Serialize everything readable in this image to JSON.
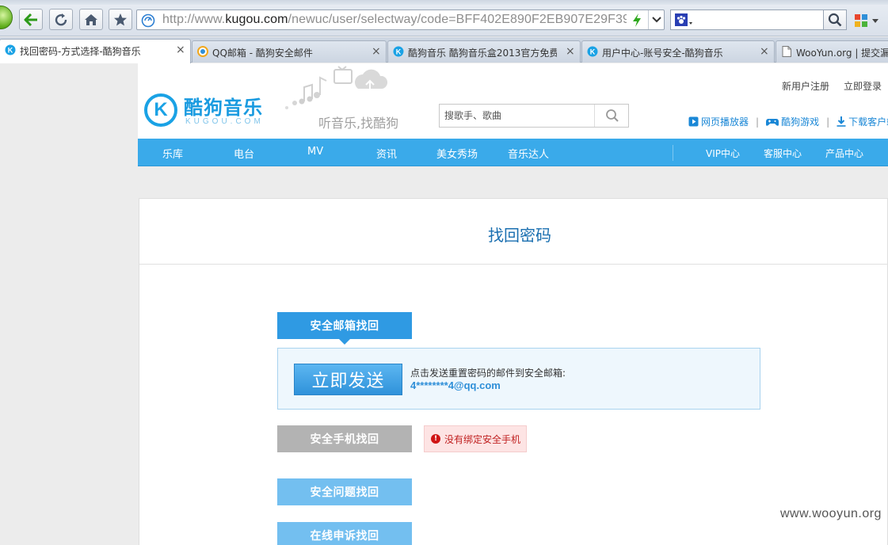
{
  "browser": {
    "url_prefix": "http://www.",
    "url_domain": "kugou.com",
    "url_path": "/newuc/user/selectway/code=BFF402E890F2EB907E29F39",
    "search_value": ""
  },
  "tabs": [
    {
      "label": "找回密码-方式选择-酷狗音乐",
      "close": "×"
    },
    {
      "label": "QQ邮箱 - 酷狗安全邮件",
      "close": "×"
    },
    {
      "label": "酷狗音乐 酷狗音乐盒2013官方免费",
      "close": "×"
    },
    {
      "label": "用户中心-账号安全-酷狗音乐",
      "close": "×"
    },
    {
      "label": "WooYun.org | 提交漏洞"
    }
  ],
  "header": {
    "logo_cn": "酷狗音乐",
    "logo_en": "KUGOU.COM",
    "logo_letter": "K",
    "slogan": "听音乐,找酷狗",
    "register": "新用户注册",
    "login": "立即登录",
    "search_placeholder": "搜歌手、歌曲",
    "links": [
      "网页播放器",
      "酷狗游戏",
      "下载客户端"
    ],
    "link_sep": "|"
  },
  "nav": {
    "items": [
      "乐库",
      "电台",
      "MV",
      "资讯",
      "美女秀场",
      "音乐达人"
    ],
    "right_items": [
      "VIP中心",
      "客服中心",
      "产品中心"
    ]
  },
  "panel": {
    "title": "找回密码",
    "email_option": "安全邮箱找回",
    "send_button": "立即发送",
    "send_desc": "点击发送重置密码的邮件到安全邮箱:",
    "masked_email": "4********4@qq.com",
    "phone_option": "安全手机找回",
    "phone_warning": "没有绑定安全手机",
    "warning_mark": "!",
    "question_option": "安全问题找回",
    "appeal_option": "在线申诉找回"
  },
  "watermark": "www.wooyun.org",
  "colors": {
    "brand_blue": "#1aa2e5",
    "nav_blue": "#3aaaea",
    "button_blue": "#2f9ae3",
    "disabled_gray": "#b3b3b3",
    "warning_red": "#c02020"
  }
}
